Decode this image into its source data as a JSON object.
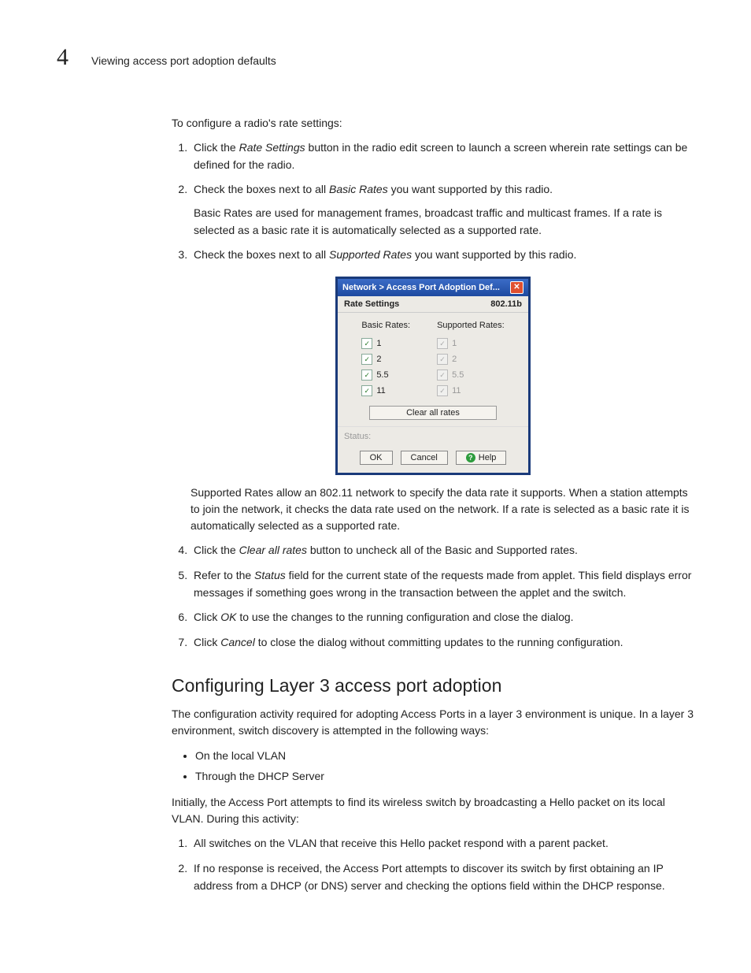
{
  "header": {
    "chapter": "4",
    "title": "Viewing access port adoption defaults"
  },
  "intro": "To configure a radio's rate settings:",
  "steps_a": [
    {
      "pre": "Click the ",
      "em": "Rate Settings",
      "post": " button in the radio edit screen to launch a screen wherein rate settings can be defined for the radio."
    },
    {
      "pre": "Check the boxes next to all ",
      "em": "Basic Rates",
      "post": " you want supported by this radio.",
      "extra": "Basic Rates are used for management frames, broadcast traffic and multicast frames. If a rate is selected as a basic rate it is automatically selected as a supported rate."
    },
    {
      "pre": "Check the boxes next to all ",
      "em": "Supported Rates",
      "post": " you want supported by this radio."
    }
  ],
  "dialog": {
    "title": "Network > Access Port Adoption Def...",
    "sub_left": "Rate Settings",
    "sub_right": "802.11b",
    "col_basic": "Basic Rates:",
    "col_supported": "Supported Rates:",
    "rates": [
      "1",
      "2",
      "5.5",
      "11"
    ],
    "clear": "Clear all rates",
    "status_label": "Status:",
    "ok": "OK",
    "cancel": "Cancel",
    "help": "Help"
  },
  "after_dialog": "Supported Rates allow an 802.11 network to specify the data rate it supports. When a station attempts to join the network, it checks the data rate used on the network. If a rate is selected as a basic rate it is automatically selected as a supported rate.",
  "steps_b": [
    {
      "pre": "Click the ",
      "em": "Clear all rates",
      "post": " button to uncheck all of the Basic and Supported rates."
    },
    {
      "pre": "Refer to the ",
      "em": "Status",
      "post": " field for the current state of the requests made from applet. This field displays error messages if something goes wrong in the transaction between the applet and the switch."
    },
    {
      "pre": "Click ",
      "em": "OK",
      "post": " to use the changes to the running configuration and close the dialog."
    },
    {
      "pre": "Click ",
      "em": "Cancel",
      "post": " to close the dialog without committing updates to the running configuration."
    }
  ],
  "section2": {
    "title": "Configuring Layer 3 access port adoption",
    "p1": "The configuration activity required for adopting Access Ports in a layer 3 environment is unique. In a layer 3 environment, switch discovery is attempted in the following ways:",
    "bullets": [
      "On the local VLAN",
      "Through the DHCP Server"
    ],
    "p2": "Initially, the Access Port attempts to find its wireless switch by broadcasting a Hello packet on its local VLAN. During this activity:",
    "num": [
      "All switches on the VLAN that receive this Hello packet respond with a parent packet.",
      "If no response is received, the Access Port attempts to discover its switch by first obtaining an IP address from a DHCP (or DNS) server and checking the options field within the DHCP response."
    ]
  }
}
